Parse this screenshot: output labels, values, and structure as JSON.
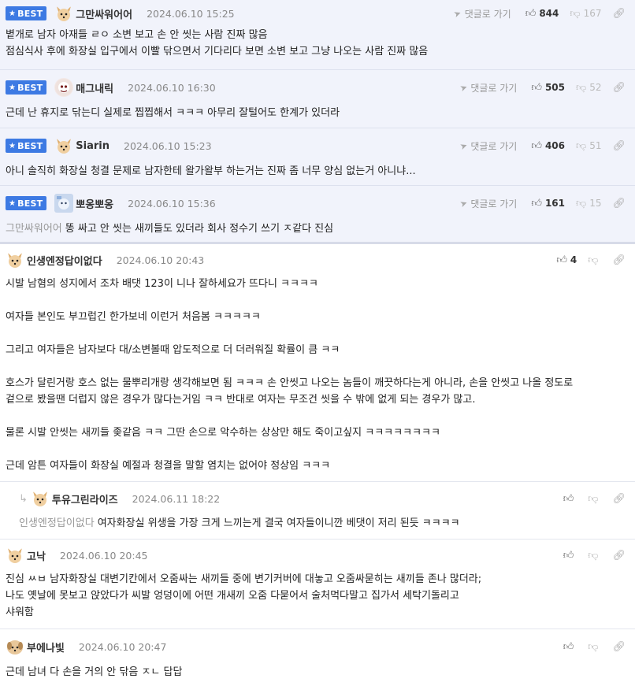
{
  "labels": {
    "best": "BEST",
    "reply_to": "댓글로 가기"
  },
  "comments": [
    {
      "nick": "그만싸워어어",
      "date": "2024.06.10 15:25",
      "up": "844",
      "down": "167",
      "lines": [
        "볕개로 남자 아재들 ㄹㅇ 소변 보고 손 안 씻는 사람 진짜 많음",
        "점심식사 후에 화장실 입구에서 이빨 닦으면서 기다리다 보면 소변 보고 그냥 나오는 사람 진짜 많음"
      ]
    },
    {
      "nick": "매그내릭",
      "date": "2024.06.10 16:30",
      "up": "505",
      "down": "52",
      "lines": [
        "근데 난 휴지로 닦는디 실제로 찝찝해서 ㅋㅋㅋ 아무리 잘털어도 한계가 있더라"
      ]
    },
    {
      "nick": "Siarin",
      "date": "2024.06.10 15:23",
      "up": "406",
      "down": "51",
      "lines": [
        "아니 솔직히 화장실 청결 문제로 남자한테 왈가왈부 하는거는 진짜 좀 너무 양심 없는거 아니냐..."
      ]
    },
    {
      "nick": "뽀옹뽀옹",
      "date": "2024.06.10 15:36",
      "up": "161",
      "down": "15",
      "mention": "그만싸워어어",
      "lines": [
        "똥 싸고 안 씻는 새끼들도 있더라 회사 정수기 쓰기 ㅈ같다 진심"
      ]
    },
    {
      "nick": "인생엔정답이없다",
      "date": "2024.06.10 20:43",
      "up": "4",
      "lines": [
        "시발 남혐의 성지에서 조차 배댓 123이 니나 잘하세요가 뜨다니 ㅋㅋㅋㅋ",
        "",
        "여자들 본인도 부끄럽긴 한가보네 이런거 처음봄 ㅋㅋㅋㅋㅋ",
        "",
        "그리고 여자들은 남자보다 대/소변볼때 압도적으로 더 더러워질 확률이 큼 ㅋㅋ",
        "",
        "호스가 달린거랑 호스 없는 물뿌리개랑 생각해보면 됨 ㅋㅋㅋ 손 안씻고 나오는 놈들이 깨끗하다는게 아니라, 손을 안씻고 나올 정도로",
        "겉으로 봤을땐 더럽지 않은 경우가 많다는거임 ㅋㅋ 반대로 여자는 무조건 씻을 수 밖에 없게 되는 경우가 많고.",
        "",
        "물론 시발 안씻는 새끼들 좆같음 ㅋㅋ 그딴 손으로 악수하는 상상만 해도 죽이고싶지 ㅋㅋㅋㅋㅋㅋㅋㅋ",
        "",
        "근데 암튼 여자들이 화장실 예절과 청결을 말할 염치는 없어야 정상임 ㅋㅋㅋ"
      ]
    },
    {
      "nick": "투유그린라이즈",
      "date": "2024.06.11 18:22",
      "mention": "인생엔정답이없다",
      "lines": [
        "여자화장실 위생을 가장 크게 느끼는게 결국 여자들이니깐 베댓이 저리 된듯 ㅋㅋㅋㅋ"
      ]
    },
    {
      "nick": "고낙",
      "date": "2024.06.10 20:45",
      "lines": [
        "진심 ㅆㅂ 남자화장실 대변기칸에서 오줌싸는 새끼들 중에 변기커버에 대놓고 오줌싸묻히는 새끼들 존나 많더라;",
        "나도 옛날에 못보고 앉았다가 씨발 엉덩이에 어떤 개새끼 오줌 다묻어서 술처먹다말고 집가서 세탁기돌리고",
        "샤워함"
      ]
    },
    {
      "nick": "부에나빛",
      "date": "2024.06.10 20:47",
      "lines": [
        "근데 남녀 다 손을 거의 안 닦음 ㅈㄴ 답답"
      ]
    }
  ]
}
